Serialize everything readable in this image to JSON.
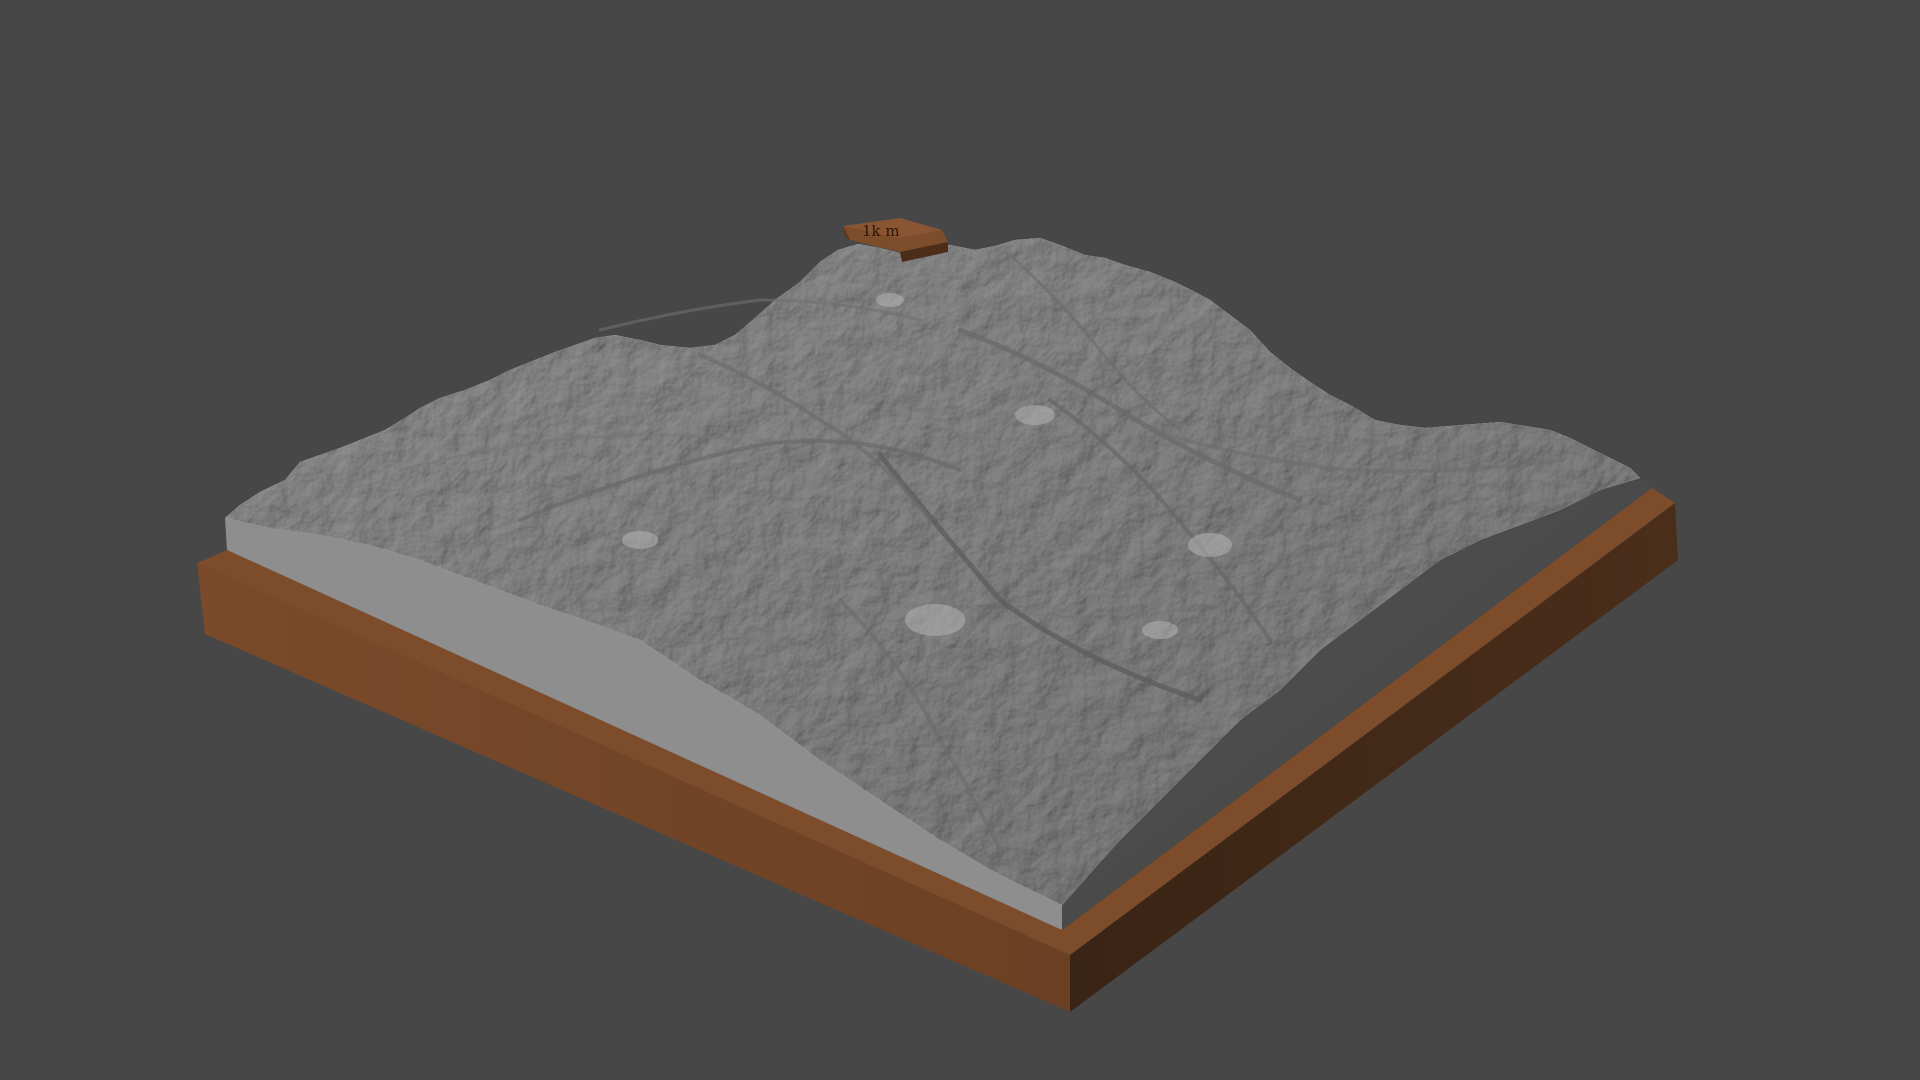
{
  "scene": {
    "background_color": "#474747",
    "terrain_color": "#8c8c8c",
    "base_color": "#6e4226"
  },
  "label_tag": {
    "text": "1k m"
  }
}
